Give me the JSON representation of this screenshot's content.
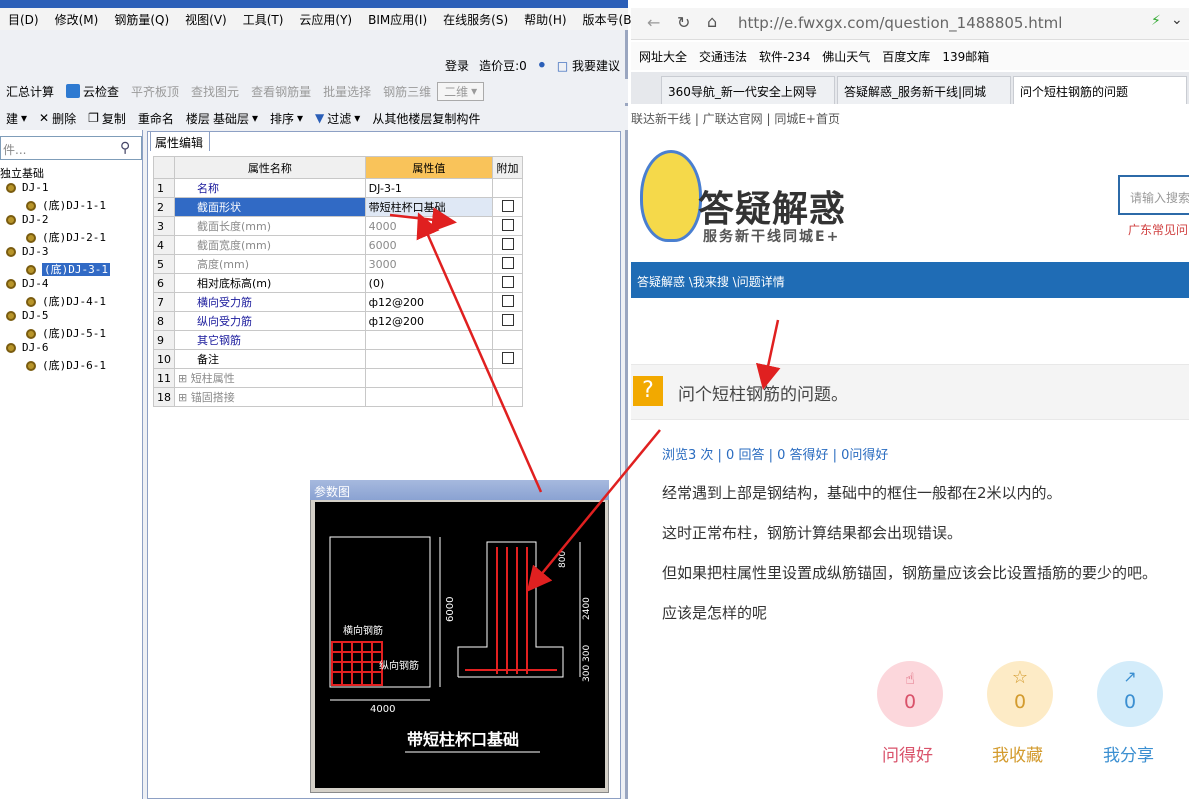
{
  "app": {
    "menu": [
      "目(D)",
      "修改(M)",
      "钢筋量(Q)",
      "视图(V)",
      "工具(T)",
      "云应用(Y)",
      "BIM应用(I)",
      "在线服务(S)",
      "帮助(H)",
      "版本号(B)"
    ],
    "login": {
      "login": "登录",
      "price_beans": "造价豆:0",
      "suggest": "我要建议"
    },
    "toolbar1": [
      "汇总计算",
      "云检查",
      "平齐板顶",
      "查找图元",
      "查看钢筋量",
      "批量选择",
      "钢筋三维",
      "二维"
    ],
    "toolbar2": {
      "new": "建",
      "delete": "删除",
      "copy": "复制",
      "rename": "重命名",
      "floor_label": "楼层",
      "floor_value": "基础层",
      "sort": "排序",
      "filter": "过滤",
      "copy_from_floor": "从其他楼层复制构件"
    },
    "search_placeholder": "件...",
    "tree": {
      "root": "独立基础",
      "items": [
        {
          "name": "DJ-1",
          "child": "(底)DJ-1-1"
        },
        {
          "name": "DJ-2",
          "child": "(底)DJ-2-1"
        },
        {
          "name": "DJ-3",
          "child": "(底)DJ-3-1"
        },
        {
          "name": "DJ-4",
          "child": "(底)DJ-4-1"
        },
        {
          "name": "DJ-5",
          "child": "(底)DJ-5-1"
        },
        {
          "name": "DJ-6",
          "child": "(底)DJ-6-1"
        }
      ]
    },
    "prop_tab": "属性编辑",
    "prop_headers": {
      "name": "属性名称",
      "value": "属性值",
      "extra": "附加"
    },
    "props": [
      {
        "n": "1",
        "name": "名称",
        "value": "DJ-3-1",
        "cb": false,
        "style": "blue"
      },
      {
        "n": "2",
        "name": "截面形状",
        "value": "带短柱杯口基础",
        "cb": true,
        "style": "sel"
      },
      {
        "n": "3",
        "name": "截面长度(mm)",
        "value": "4000",
        "cb": true,
        "style": "gray"
      },
      {
        "n": "4",
        "name": "截面宽度(mm)",
        "value": "6000",
        "cb": true,
        "style": "gray"
      },
      {
        "n": "5",
        "name": "高度(mm)",
        "value": "3000",
        "cb": true,
        "style": "gray"
      },
      {
        "n": "6",
        "name": "相对底标高(m)",
        "value": "(0)",
        "cb": true,
        "style": ""
      },
      {
        "n": "7",
        "name": "横向受力筋",
        "value": "ф12@200",
        "cb": true,
        "style": "blue"
      },
      {
        "n": "8",
        "name": "纵向受力筋",
        "value": "ф12@200",
        "cb": true,
        "style": "blue"
      },
      {
        "n": "9",
        "name": "其它钢筋",
        "value": "",
        "cb": false,
        "style": "blue"
      },
      {
        "n": "10",
        "name": "备注",
        "value": "",
        "cb": true,
        "style": ""
      },
      {
        "n": "11",
        "name": "短柱属性",
        "value": "",
        "cb": false,
        "style": "gray",
        "expand": true
      },
      {
        "n": "18",
        "name": "锚固搭接",
        "value": "",
        "cb": false,
        "style": "gray",
        "expand": true
      }
    ],
    "param": {
      "title": "参数图",
      "label_h": "横向钢筋",
      "label_v": "纵向钢筋",
      "dim_w": "4000",
      "dim_h": "6000",
      "dim_800": "800",
      "dim_2400": "2400",
      "dim_300a": "300",
      "dim_300b": "300",
      "caption": "带短柱杯口基础"
    }
  },
  "browser": {
    "url": "http://e.fwxgx.com/question_1488805.html",
    "bookmarks": [
      "网址大全",
      "交通违法",
      "软件-234",
      "佛山天气",
      "百度文库",
      "139邮箱"
    ],
    "tabs": [
      "360导航_新一代安全上网导",
      "答疑解惑_服务新干线|同城",
      "问个短柱钢筋的问题"
    ],
    "sitenav": "联达新干线  |  广联达官网  |  同城E+首页",
    "logo_title": "答疑解惑",
    "logo_sub": "服务新干线同城E+",
    "search_placeholder": "请输入搜索",
    "hotline": "广东常见问",
    "breadcrumb": "答疑解惑 \\我来搜 \\问题详情",
    "question_title": "问个短柱钢筋的问题。",
    "stats": "浏览3 次 | 0 回答 | 0 答得好 | 0问得好",
    "paragraphs": [
      "经常遇到上部是钢结构，基础中的框住一般都在2米以内的。",
      "这时正常布柱，钢筋计算结果都会出现错误。",
      "但如果把柱属性里设置成纵筋锚固，钢筋量应该会比设置插筋的要少的吧。",
      "应该是怎样的呢"
    ],
    "actions": [
      {
        "label": "问得好",
        "count": "0",
        "color": "#fcd7dc",
        "text": "#d9526a"
      },
      {
        "label": "我收藏",
        "count": "0",
        "color": "#fdebc6",
        "text": "#d39b2e"
      },
      {
        "label": "我分享",
        "count": "0",
        "color": "#d3ecfa",
        "text": "#3b8fd1"
      }
    ]
  },
  "colors": {
    "arrow": "#e02020",
    "select": "#316ac5",
    "accent": "#1f6cb5"
  }
}
